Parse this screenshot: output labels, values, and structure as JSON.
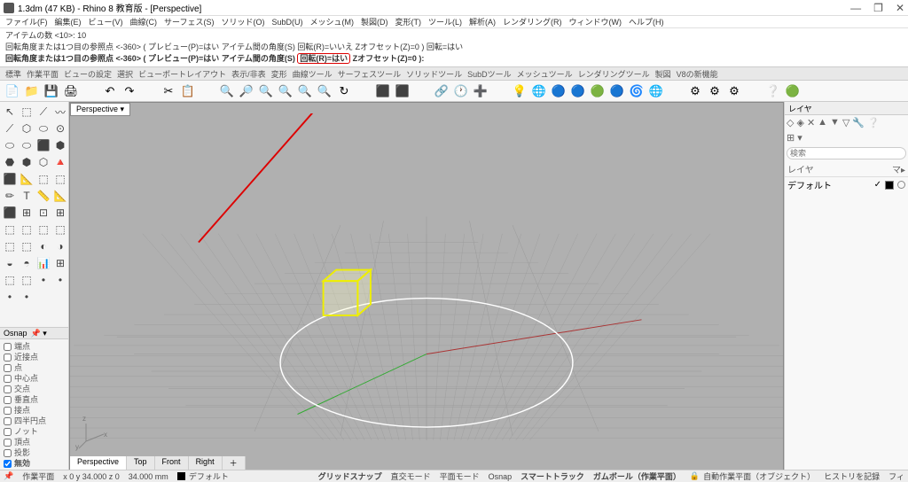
{
  "title": "1.3dm (47 KB) - Rhino 8 教育版 - [Perspective]",
  "menus": [
    "ファイル(F)",
    "編集(E)",
    "ビュー(V)",
    "曲線(C)",
    "サーフェス(S)",
    "ソリッド(O)",
    "SubD(U)",
    "メッシュ(M)",
    "製図(D)",
    "変形(T)",
    "ツール(L)",
    "解析(A)",
    "レンダリング(R)",
    "ウィンドウ(W)",
    "ヘルプ(H)"
  ],
  "cmd": {
    "l0": "アイテムの数 <10>: 10",
    "l1": "回転角度または1つ目の参照点 <-360> ( プレビュー(P)=はい  アイテム間の角度(S)  回転(R)=いいえ  Zオフセット(Z)=0 ) 回転=はい",
    "l2a": "回転角度または1つ目の参照点 <-360> ( プレビュー(P)=はい アイテム間の角度(S) ",
    "l2b": "回転(R)=はい",
    "l2c": " Zオフセット(Z)=0 ):"
  },
  "tabs": [
    "標準",
    "作業平面",
    "ビューの設定",
    "選択",
    "ビューポートレイアウト",
    "表示/非表",
    "変形",
    "曲線ツール",
    "サーフェスツール",
    "ソリッドツール",
    "SubDツール",
    "メッシュツール",
    "レンダリングツール",
    "製図",
    "V8の新機能"
  ],
  "toolbar_icons": [
    "📄",
    "📁",
    "💾",
    "🖨",
    "   ",
    "↶",
    "↷",
    "   ",
    "✂",
    "📋",
    "   ",
    "🔍",
    "🔎",
    "🔍",
    "🔍",
    "🔍",
    "🔍",
    "↻",
    "   ",
    "⬛",
    "⬛",
    "   ",
    "🔗",
    "🕐",
    "➕",
    "   ",
    "💡",
    "🌐",
    "🔵",
    "🔵",
    "🟢",
    "🔵",
    "🌀",
    "🌐",
    "   ",
    "⚙",
    "⚙",
    "⚙",
    "   ",
    "❔",
    "🟢"
  ],
  "left_tools": [
    "↖",
    "⬚",
    "⟋",
    "〰",
    "⟋",
    "⬡",
    "⬭",
    "⊙",
    "⬭",
    "⬭",
    "⬛",
    "⬢",
    "⬣",
    "⬢",
    "⬡",
    "🔺",
    "⬛",
    "📐",
    "⬚",
    "⬚",
    "✏",
    "T",
    "📏",
    "📐",
    "⬛",
    "⊞",
    "⊡",
    "⊞",
    "⬚",
    "⬚",
    "⬚",
    "⬚",
    "⬚",
    "⬚",
    "◐",
    "◑",
    "◒",
    "◓",
    "📊",
    "⊞",
    "⬚",
    "⬚",
    "•",
    "•",
    "•",
    "•"
  ],
  "osnap": {
    "title": "Osnap",
    "items": [
      "端点",
      "近接点",
      "点",
      "中心点",
      "交点",
      "垂直点",
      "接点",
      "四半円点",
      "ノット",
      "頂点",
      "投影"
    ],
    "disable": "無効"
  },
  "viewport": {
    "label": "Perspective ▾",
    "tabs": [
      "Perspective",
      "Top",
      "Front",
      "Right",
      "＋"
    ]
  },
  "right": {
    "title": "レイヤ",
    "search_ph": "検索",
    "col_layer": "レイヤ",
    "col_m": "マ▸",
    "default": "デフォルト"
  },
  "status": {
    "wp": "作業平面",
    "coord": "x 0   y 34.000   z 0",
    "dim": "34.000 mm",
    "deflayer": "デフォルト",
    "items": [
      "グリッドスナップ",
      "直交モード",
      "平面モード",
      "Osnap",
      "スマートトラック",
      "ガムボール（作業平面）",
      "自動作業平面（オブジェクト）",
      "ヒストリを記録",
      "フィ"
    ]
  },
  "axis": {
    "x": "x",
    "y": "y",
    "z": "z"
  }
}
